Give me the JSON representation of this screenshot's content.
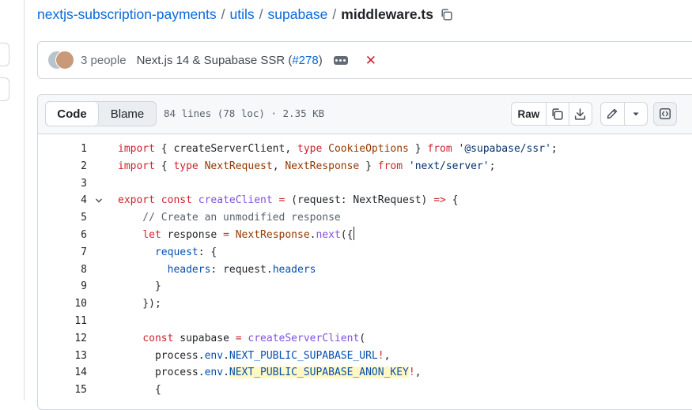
{
  "breadcrumb": {
    "repo": "nextjs-subscription-payments",
    "sep": "/",
    "dir1": "utils",
    "dir2": "supabase",
    "file": "middleware.ts"
  },
  "commit": {
    "people": "3 people",
    "message": "Next.js 14 & Supabase SSR (",
    "pr": "#278",
    "message_end": ")",
    "status": "✕"
  },
  "file_header": {
    "code_tab": "Code",
    "blame_tab": "Blame",
    "meta": "84 lines (78 loc) · 2.35 KB",
    "raw_label": "Raw"
  },
  "code": {
    "lines": [
      {
        "n": "1",
        "tokens": [
          [
            "kw",
            "import"
          ],
          [
            "p",
            " { "
          ],
          [
            "fn2",
            "createServerClient"
          ],
          [
            "p",
            ", "
          ],
          [
            "kw",
            "type"
          ],
          [
            "p",
            " "
          ],
          [
            "ty",
            "CookieOptions"
          ],
          [
            "p",
            " } "
          ],
          [
            "kw",
            "from"
          ],
          [
            "p",
            " "
          ],
          [
            "str",
            "'@supabase/ssr'"
          ],
          [
            "p",
            ";"
          ]
        ]
      },
      {
        "n": "2",
        "tokens": [
          [
            "kw",
            "import"
          ],
          [
            "p",
            " { "
          ],
          [
            "kw",
            "type"
          ],
          [
            "p",
            " "
          ],
          [
            "ty",
            "NextRequest"
          ],
          [
            "p",
            ", "
          ],
          [
            "ty",
            "NextResponse"
          ],
          [
            "p",
            " } "
          ],
          [
            "kw",
            "from"
          ],
          [
            "p",
            " "
          ],
          [
            "str",
            "'next/server'"
          ],
          [
            "p",
            ";"
          ]
        ]
      },
      {
        "n": "3",
        "tokens": []
      },
      {
        "n": "4",
        "fold": true,
        "tokens": [
          [
            "kw",
            "export"
          ],
          [
            "p",
            " "
          ],
          [
            "kw",
            "const"
          ],
          [
            "p",
            " "
          ],
          [
            "fn",
            "createClient"
          ],
          [
            "p",
            " "
          ],
          [
            "kw",
            "="
          ],
          [
            "p",
            " (request: NextRequest) "
          ],
          [
            "kw",
            "=>"
          ],
          [
            "p",
            " {"
          ]
        ]
      },
      {
        "n": "5",
        "tokens": [
          [
            "cm",
            "    // Create an unmodified response"
          ]
        ]
      },
      {
        "n": "6",
        "caret": true,
        "tokens": [
          [
            "p",
            "    "
          ],
          [
            "kw",
            "let"
          ],
          [
            "p",
            " response "
          ],
          [
            "kw",
            "="
          ],
          [
            "p",
            " "
          ],
          [
            "ty",
            "NextResponse"
          ],
          [
            "p",
            "."
          ],
          [
            "fn",
            "next"
          ],
          [
            "p",
            "({"
          ]
        ]
      },
      {
        "n": "7",
        "tokens": [
          [
            "p",
            "      "
          ],
          [
            "prop",
            "request"
          ],
          [
            "p",
            ": {"
          ]
        ]
      },
      {
        "n": "8",
        "tokens": [
          [
            "p",
            "        "
          ],
          [
            "prop",
            "headers"
          ],
          [
            "p",
            ": request."
          ],
          [
            "prop",
            "headers"
          ]
        ]
      },
      {
        "n": "9",
        "tokens": [
          [
            "p",
            "      }"
          ]
        ]
      },
      {
        "n": "10",
        "tokens": [
          [
            "p",
            "    });"
          ]
        ]
      },
      {
        "n": "11",
        "tokens": []
      },
      {
        "n": "12",
        "tokens": [
          [
            "p",
            "    "
          ],
          [
            "kw",
            "const"
          ],
          [
            "p",
            " supabase "
          ],
          [
            "kw",
            "="
          ],
          [
            "p",
            " "
          ],
          [
            "fn",
            "createServerClient"
          ],
          [
            "p",
            "("
          ]
        ]
      },
      {
        "n": "13",
        "tokens": [
          [
            "p",
            "      process."
          ],
          [
            "prop",
            "env"
          ],
          [
            "p",
            "."
          ],
          [
            "prop",
            "NEXT_PUBLIC_SUPABASE_URL"
          ],
          [
            "kw",
            "!"
          ],
          [
            "p",
            ","
          ]
        ]
      },
      {
        "n": "14",
        "tokens": [
          [
            "p",
            "      process."
          ],
          [
            "prop",
            "env"
          ],
          [
            "p",
            "."
          ],
          [
            "hl",
            "NEXT_PUBLIC_SUPABASE_ANON_KEY"
          ],
          [
            "kw",
            "!"
          ],
          [
            "p",
            ","
          ]
        ]
      },
      {
        "n": "15",
        "tokens": [
          [
            "p",
            "      {"
          ]
        ]
      }
    ]
  },
  "colors": {
    "kw": "#cf222e",
    "str": "#0a3069",
    "fn": "#8250df",
    "fn2": "#1f2328",
    "ty": "#953800",
    "prop": "#0550ae",
    "cm": "#59636e",
    "p": "#1f2328",
    "highlight_bg": "#fff8c5",
    "link": "#0969da"
  },
  "icons": {
    "copy": "copy-icon",
    "download": "download-icon",
    "edit": "pencil-icon",
    "menu": "triangle-down-icon",
    "symbols": "code-square-icon"
  }
}
